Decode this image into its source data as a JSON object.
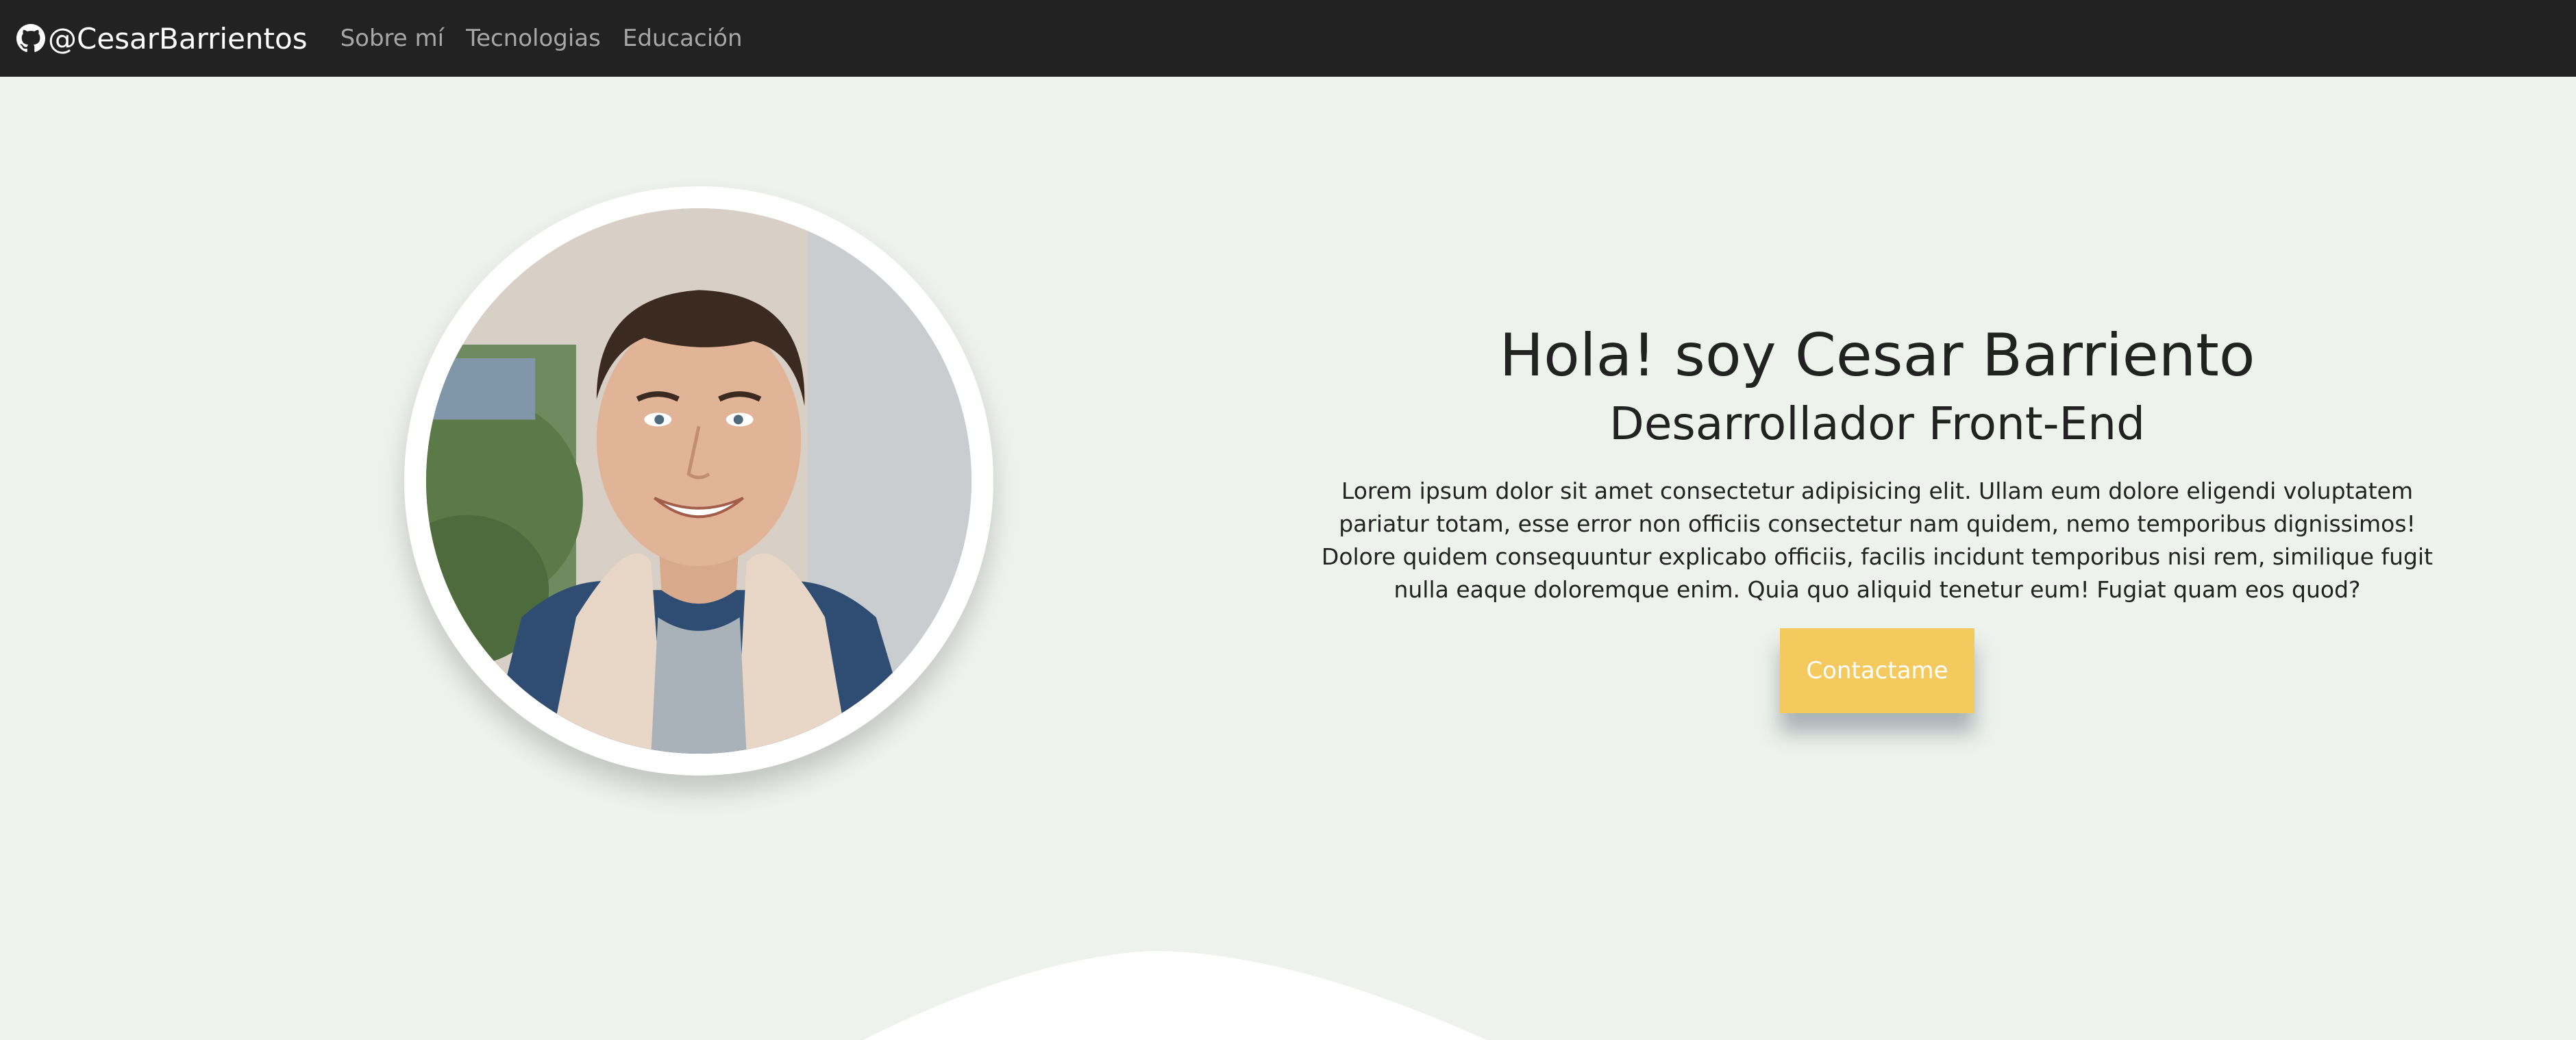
{
  "navbar": {
    "brand_label": "@CesarBarrientos",
    "brand_icon": "github-icon",
    "links": [
      {
        "label": "Sobre mí"
      },
      {
        "label": "Tecnologias"
      },
      {
        "label": "Educación"
      }
    ]
  },
  "hero": {
    "title": "Hola! soy Cesar Barriento",
    "subtitle": "Desarrollador Front-End",
    "description": "Lorem ipsum dolor sit amet consectetur adipisicing elit. Ullam eum dolore eligendi voluptatem pariatur totam, esse error non officiis consectetur nam quidem, nemo temporibus dignissimos! Dolore quidem consequuntur explicabo officiis, facilis incidunt temporibus nisi rem, similique fugit nulla eaque doloremque enim. Quia quo aliquid tenetur eum! Fugiat quam eos quod?",
    "cta_label": "Contactame"
  },
  "colors": {
    "navbar_bg": "#222222",
    "page_bg": "#eef2ec",
    "cta_bg": "#f4ca5e",
    "text": "#222222",
    "nav_link": "#a7a7a7"
  }
}
